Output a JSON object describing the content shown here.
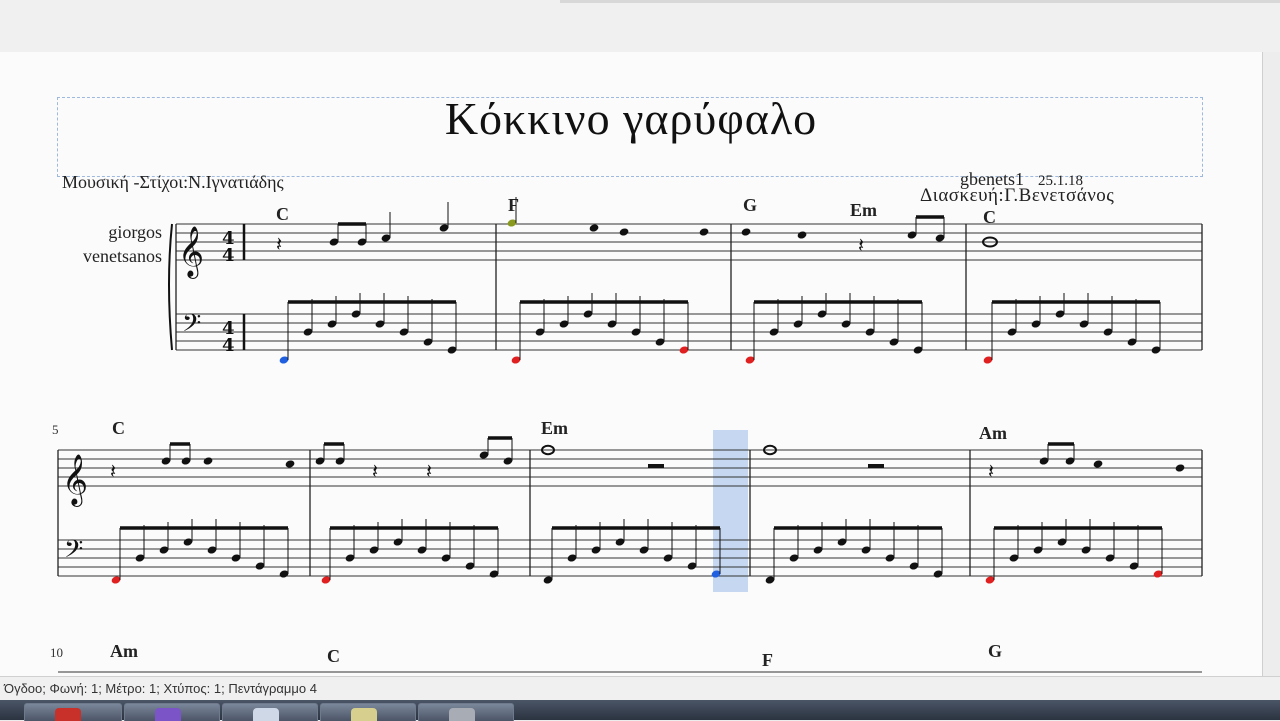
{
  "score": {
    "title": "Κόκκινο γαρύφαλο",
    "composer": "Μουσική -Στίχοι:Ν.Ιγνατιάδης",
    "credit_user": "gbenets1",
    "credit_date": "25.1.18",
    "arranger": "Διασκευή:Γ.Βενετσάνος",
    "instrument_line1": "giorgos",
    "instrument_line2": "venetsanos",
    "time_signature": "4/4",
    "chords_system1": [
      "C",
      "F",
      "G",
      "Em",
      "C"
    ],
    "chords_system2": [
      "C",
      "Em",
      "Am"
    ],
    "chords_system3": [
      "Am",
      "C",
      "F",
      "G"
    ],
    "measure_numbers": [
      "5",
      "10"
    ]
  },
  "status_bar": {
    "text": "Όγδοο; Φωνή: 1;  Μέτρο: 1;  Χτύπος: 1;  Πεντάγραμμο 4"
  },
  "colors": {
    "selection": "#bcd0f0",
    "note_red": "#e02020",
    "note_blue": "#2060e0",
    "note_olive": "#8a9a20"
  },
  "taskbar": {
    "icons": [
      "app-red-icon",
      "viber-icon",
      "app-blue-icon",
      "folder-icon",
      "app-gray-icon"
    ]
  }
}
